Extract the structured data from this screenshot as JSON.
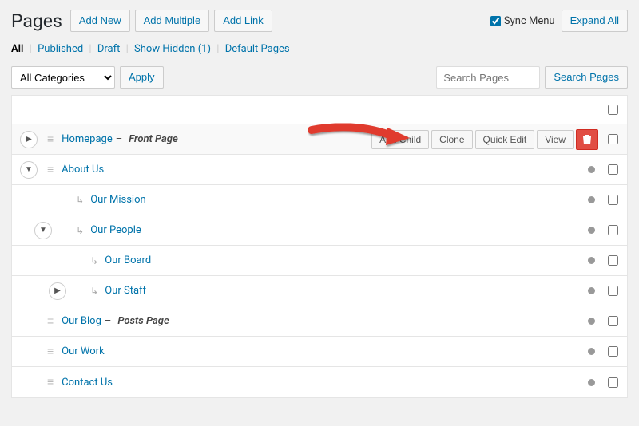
{
  "header": {
    "title": "Pages",
    "add_new": "Add New",
    "add_multiple": "Add Multiple",
    "add_link": "Add Link",
    "sync_menu": "Sync Menu",
    "sync_menu_checked": true,
    "expand_all": "Expand All"
  },
  "filters": {
    "all": "All",
    "published": "Published",
    "draft": "Draft",
    "show_hidden": "Show Hidden",
    "hidden_count": "(1)",
    "default_pages": "Default Pages"
  },
  "controls": {
    "category_select": "All Categories",
    "apply": "Apply",
    "search_placeholder": "Search Pages",
    "search_button": "Search Pages"
  },
  "row_actions": {
    "add_child": "Add Child",
    "clone": "Clone",
    "quick_edit": "Quick Edit",
    "view": "View"
  },
  "pages": {
    "r0": {
      "title": "Homepage",
      "suffix": "Front Page"
    },
    "r1": {
      "title": "About Us"
    },
    "r2": {
      "title": "Our Mission"
    },
    "r3": {
      "title": "Our People"
    },
    "r4": {
      "title": "Our Board"
    },
    "r5": {
      "title": "Our Staff"
    },
    "r6": {
      "title": "Our Blog",
      "suffix": "Posts Page"
    },
    "r7": {
      "title": "Our Work"
    },
    "r8": {
      "title": "Contact Us"
    }
  }
}
